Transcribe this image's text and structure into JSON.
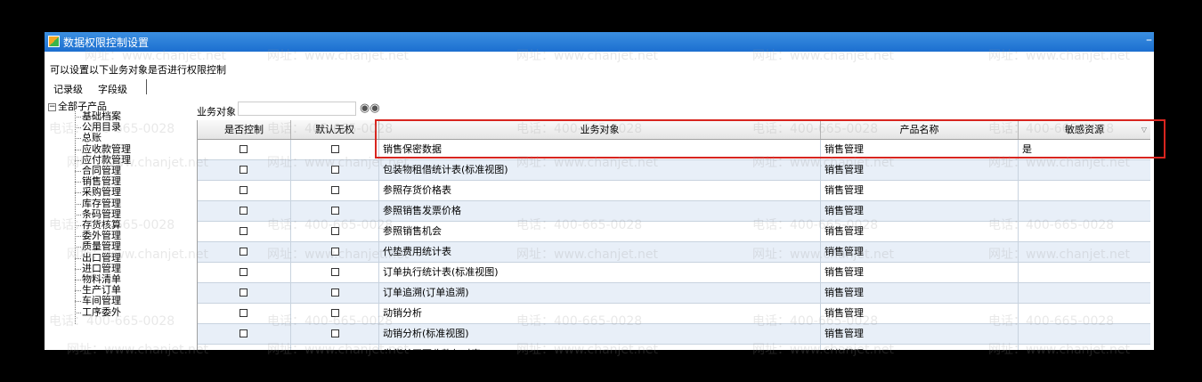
{
  "window": {
    "title": "数据权限控制设置",
    "minimize": "–"
  },
  "description": "可以设置以下业务对象是否进行权限控制",
  "tabs": [
    "记录级",
    "字段级"
  ],
  "tree": {
    "root": "全部子产品",
    "items": [
      "基础档案",
      "公用目录",
      "总账",
      "应收款管理",
      "应付款管理",
      "合同管理",
      "销售管理",
      "采购管理",
      "库存管理",
      "条码管理",
      "存货核算",
      "委外管理",
      "质量管理",
      "出口管理",
      "进口管理",
      "物料清单",
      "生产订单",
      "车间管理",
      "工序委外"
    ]
  },
  "search": {
    "label": "业务对象",
    "value": "",
    "icon": "binoculars-icon"
  },
  "table": {
    "columns": [
      "是否控制",
      "默认无权",
      "业务对象",
      "产品名称",
      "敏感资源"
    ],
    "rows": [
      {
        "obj": "销售保密数据",
        "prod": "销售管理",
        "sens": "是"
      },
      {
        "obj": "包装物租借统计表(标准视图)",
        "prod": "销售管理",
        "sens": ""
      },
      {
        "obj": "参照存货价格表",
        "prod": "销售管理",
        "sens": ""
      },
      {
        "obj": "参照销售发票价格",
        "prod": "销售管理",
        "sens": ""
      },
      {
        "obj": "参照销售机会",
        "prod": "销售管理",
        "sens": ""
      },
      {
        "obj": "代垫费用统计表",
        "prod": "销售管理",
        "sens": ""
      },
      {
        "obj": "订单执行统计表(标准视图)",
        "prod": "销售管理",
        "sens": ""
      },
      {
        "obj": "订单追溯(订单追溯)",
        "prod": "销售管理",
        "sens": ""
      },
      {
        "obj": "动销分析",
        "prod": "销售管理",
        "sens": ""
      },
      {
        "obj": "动销分析(标准视图)",
        "prod": "销售管理",
        "sens": ""
      },
      {
        "obj": "发货单开票收款勾对表",
        "prod": "销售管理",
        "sens": ""
      }
    ]
  },
  "watermarks": [
    "网址：www.chanjet.net",
    "电话：400-665-0028"
  ]
}
